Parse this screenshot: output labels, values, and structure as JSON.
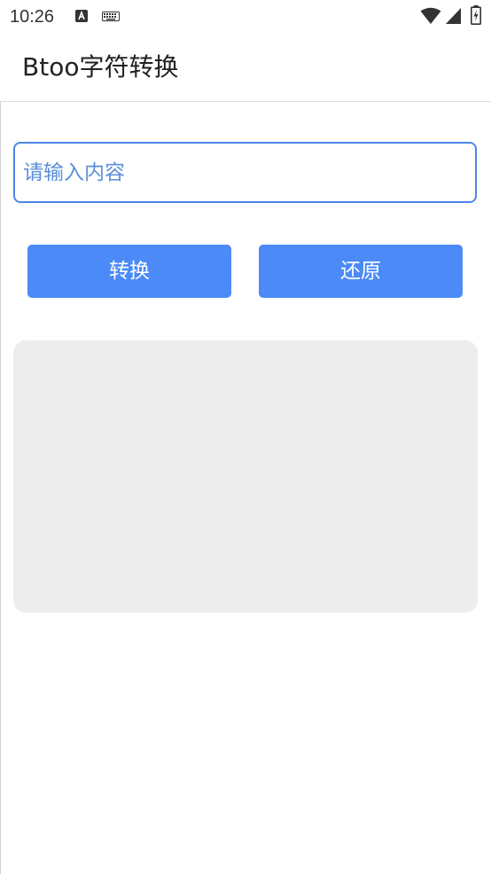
{
  "status_bar": {
    "time": "10:26",
    "left_icons": [
      "text-notification-icon",
      "keyboard-icon"
    ],
    "right_icons": [
      "wifi-icon",
      "cell-signal-icon",
      "battery-charging-icon"
    ]
  },
  "app_bar": {
    "title": "Btoo字符转换"
  },
  "input": {
    "placeholder": "请输入内容",
    "value": ""
  },
  "buttons": {
    "convert_label": "转换",
    "restore_label": "还原"
  },
  "result": {
    "text": ""
  },
  "colors": {
    "accent": "#4b8af7",
    "input_border": "#4a86e8",
    "placeholder": "#5b8fdb",
    "panel_bg": "#ededed"
  }
}
